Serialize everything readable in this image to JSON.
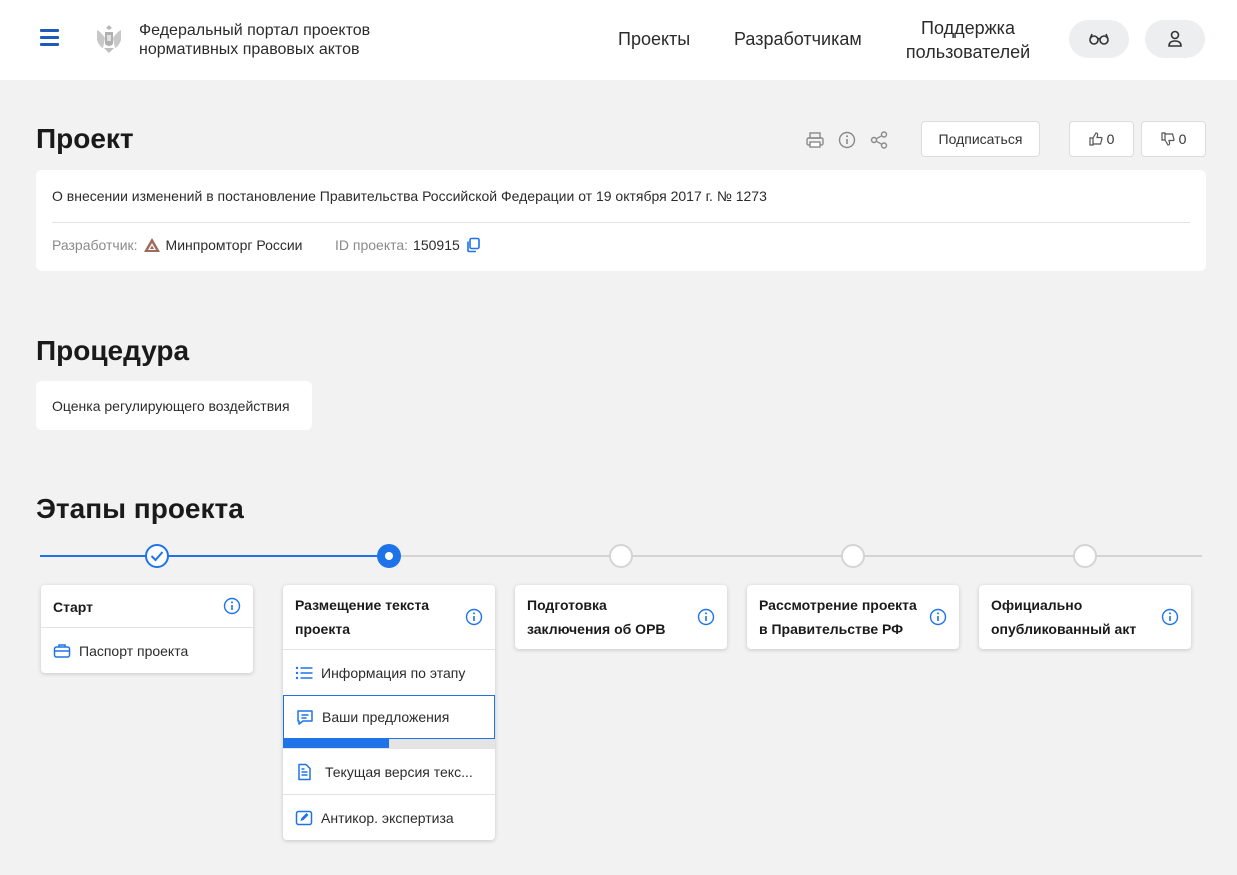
{
  "header": {
    "site_title_line1": "Федеральный портал проектов",
    "site_title_line2": "нормативных правовых актов",
    "nav": {
      "projects": "Проекты",
      "developers": "Разработчикам",
      "support": "Поддержка пользователей"
    }
  },
  "project": {
    "title": "Проект",
    "subscribe_label": "Подписаться",
    "likes": "0",
    "dislikes": "0",
    "name": "О внесении изменений в постановление Правительства Российской Федерации от 19 октября 2017 г. № 1273",
    "developer_label": "Разработчик:",
    "developer_value": "Минпромторг России",
    "id_label": "ID проекта:",
    "id_value": "150915"
  },
  "procedure": {
    "title": "Процедура",
    "value": "Оценка регулирующего воздействия"
  },
  "stages": {
    "title": "Этапы проекта",
    "progress_fraction": 0.5,
    "items": [
      {
        "title": "Старт",
        "status": "done",
        "subitems": [
          {
            "label": "Паспорт проекта",
            "icon": "briefcase-icon"
          }
        ]
      },
      {
        "title": "Размещение текста проекта",
        "status": "current",
        "subitems": [
          {
            "label": "Информация по этапу",
            "icon": "list-icon"
          },
          {
            "label": "Ваши предложения",
            "icon": "comment-icon",
            "active": true,
            "progress": 0.5
          },
          {
            "label": "Текущая версия текс...",
            "icon": "document-icon"
          },
          {
            "label": "Антикор. экспертиза",
            "icon": "edit-icon"
          }
        ]
      },
      {
        "title": "Подготовка заключения об ОРВ",
        "status": "pending"
      },
      {
        "title": "Рассмотрение проекта в Правительстве РФ",
        "status": "pending"
      },
      {
        "title": "Официально опубликованный акт",
        "status": "pending"
      }
    ]
  },
  "colors": {
    "accent": "#1e73e8",
    "header_icon": "#1e5bb8",
    "background": "#f2f2f2",
    "pending": "#d4d4d4"
  }
}
